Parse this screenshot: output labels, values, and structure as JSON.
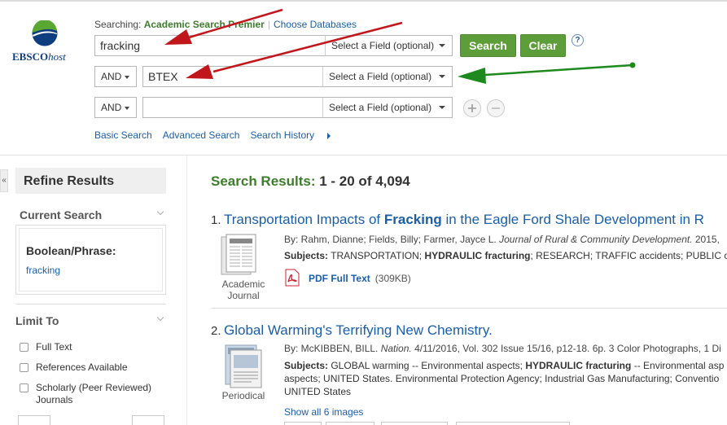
{
  "brand": {
    "logo_bold": "EBSCO",
    "logo_italic": "host"
  },
  "searching": {
    "prefix": "Searching:",
    "database": "Academic Search Premier",
    "choose_link": "Choose Databases"
  },
  "search_rows": [
    {
      "bool": "",
      "term": "fracking",
      "field": "Select a Field (optional)"
    },
    {
      "bool": "AND",
      "term": "BTEX",
      "field": "Select a Field (optional)"
    },
    {
      "bool": "AND",
      "term": "",
      "field": "Select a Field (optional)"
    }
  ],
  "buttons": {
    "search": "Search",
    "clear": "Clear",
    "help": "?"
  },
  "search_links": {
    "basic": "Basic Search",
    "advanced": "Advanced Search",
    "history": "Search History"
  },
  "sidebar": {
    "refine_title": "Refine Results",
    "collapse_glyph": "«",
    "current_search_title": "Current Search",
    "boolean_label": "Boolean/Phrase:",
    "boolean_term": "fracking",
    "limit_to_title": "Limit To",
    "limits": [
      {
        "label": "Full Text",
        "checked": false
      },
      {
        "label": "References Available",
        "checked": false
      },
      {
        "label": "Scholarly (Peer Reviewed) Journals",
        "checked": false
      }
    ]
  },
  "results": {
    "label": "Search Results:",
    "range": "1 - 20 of 4,094",
    "items": [
      {
        "num": "1.",
        "title_pre": "Transportation Impacts of ",
        "title_hit": "Fracking",
        "title_post": " in the Eagle Ford Shale Development in R",
        "authors": "By: Rahm, Dianne; Fields, Billy; Farmer, Jayce L.",
        "journal": "Journal of Rural & Community Development.",
        "pub_rest": " 2015,",
        "subjects_label": "Subjects:",
        "subjects_a": " TRANSPORTATION; ",
        "subjects_hit": "HYDRAULIC fracturing",
        "subjects_b": "; RESEARCH; TRAFFIC accidents; PUBLIC c",
        "type": "Academic Journal",
        "pdf_label": "PDF Full Text",
        "pdf_size": "(309KB)"
      },
      {
        "num": "2.",
        "title": "Global Warming's Terrifying New Chemistry.",
        "authors": "By: McKIBBEN, BILL.",
        "journal": "Nation.",
        "pub_rest": " 4/11/2016, Vol. 302 Issue 15/16, p12-18. 6p. 3 Color Photographs, 1 Di",
        "subjects_label": "Subjects:",
        "subjects_a": " GLOBAL warming -- Environmental aspects; ",
        "subjects_hit": "HYDRAULIC fracturing",
        "subjects_b": " -- Environmental asp",
        "subjects_line2": "aspects; UNITED States. Environmental Protection Agency; Industrial Gas Manufacturing; Conventio",
        "subjects_line3": "UNITED States",
        "type": "Periodical",
        "images_link": "Show all 6 images"
      }
    ]
  },
  "colors": {
    "accent_green": "#5e9e3a",
    "link_blue": "#1a5ea8",
    "annotation_red": "#c0161c",
    "annotation_green": "#1e8a1e"
  }
}
